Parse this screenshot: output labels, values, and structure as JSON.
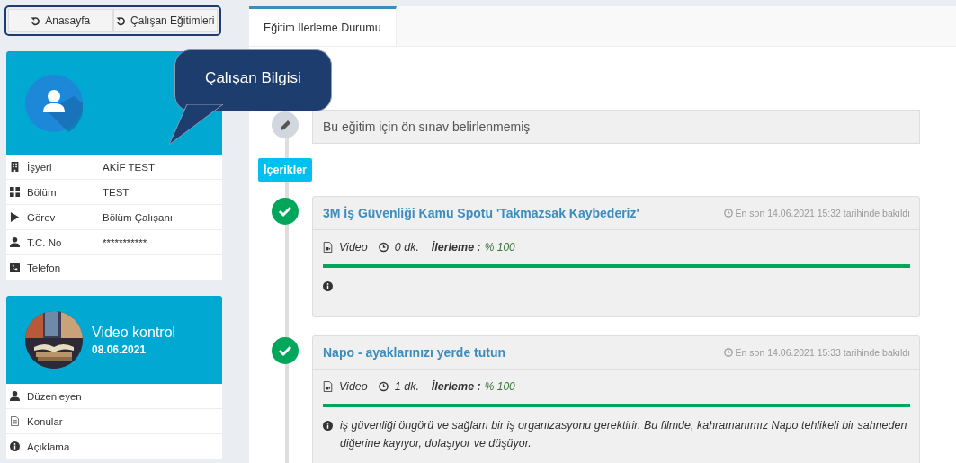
{
  "nav_buttons": [
    {
      "label": "Anasayfa"
    },
    {
      "label": "Çalışan Eğitimleri"
    }
  ],
  "employee_card": {
    "rows": [
      {
        "kind": "building",
        "label": "İşyeri",
        "value": "AKİF TEST"
      },
      {
        "kind": "grid",
        "label": "Bölüm",
        "value": "TEST"
      },
      {
        "kind": "play",
        "label": "Görev",
        "value": "Bölüm Çalışanı"
      },
      {
        "kind": "user",
        "label": "T.C. No",
        "value": "***********"
      },
      {
        "kind": "phone",
        "label": "Telefon"
      }
    ]
  },
  "tooltip": {
    "text": "Çalışan Bilgisi"
  },
  "training_card": {
    "kind": "picture",
    "title": "Video kontrol",
    "date": "08.06.2021",
    "rows": [
      {
        "kind": "user",
        "label": "Düzenleyen"
      },
      {
        "kind": "doc",
        "label": "Konular"
      },
      {
        "kind": "info",
        "label": "Açıklama"
      }
    ]
  },
  "tabs": [
    {
      "label": "Eğitim İlerleme Durumu",
      "selected": true
    }
  ],
  "pre_exam": {
    "text": "Bu eğitim için ön sınav belirlenmemiş"
  },
  "section_badge": "İçerikler",
  "contents": [
    {
      "kind": "video",
      "done": true,
      "title": "3M İş Güvenliği Kamu Spotu 'Takmazsak Kaybederiz'",
      "last_viewed": "En son 14.06.2021 15:32 tarihinde bakıldı",
      "type": "Video",
      "duration": "0 dk.",
      "progress_label": "İlerleme :",
      "progress_value": "% 100",
      "level": 1
    },
    {
      "kind": "video",
      "done": true,
      "title": "Napo - ayaklarınızı yerde tutun",
      "last_viewed": "En son 14.06.2021 15:33 tarihinde bakıldı",
      "type": "Video",
      "duration": "1 dk.",
      "progress_label": "İlerleme :",
      "progress_value": "% 100",
      "level": 1,
      "description": "iş güvenliği öngörü ve sağlam bir iş organizasyonu gerektirir. Bu filmde, kahramanımız Napo tehlikeli bir sahneden diğerine kayıyor, dolaşıyor ve düşüyor."
    }
  ]
}
